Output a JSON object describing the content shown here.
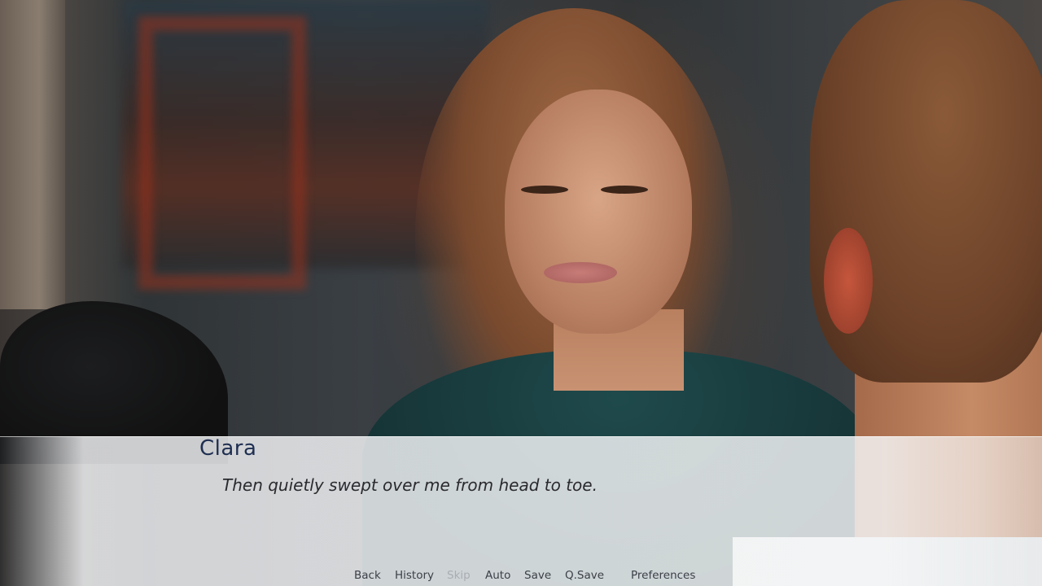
{
  "dialogue": {
    "speaker": "Clara",
    "text": "Then quietly swept over me from head to toe."
  },
  "quick_menu": {
    "back": "Back",
    "history": "History",
    "skip": "Skip",
    "auto": "Auto",
    "save": "Save",
    "qsave": "Q.Save",
    "preferences": "Preferences"
  },
  "colors": {
    "speaker_name": "#1f2f52",
    "dialogue_text": "#2a2a2e",
    "menu_text": "#3b3f48",
    "menu_disabled": "#a9adb3"
  }
}
